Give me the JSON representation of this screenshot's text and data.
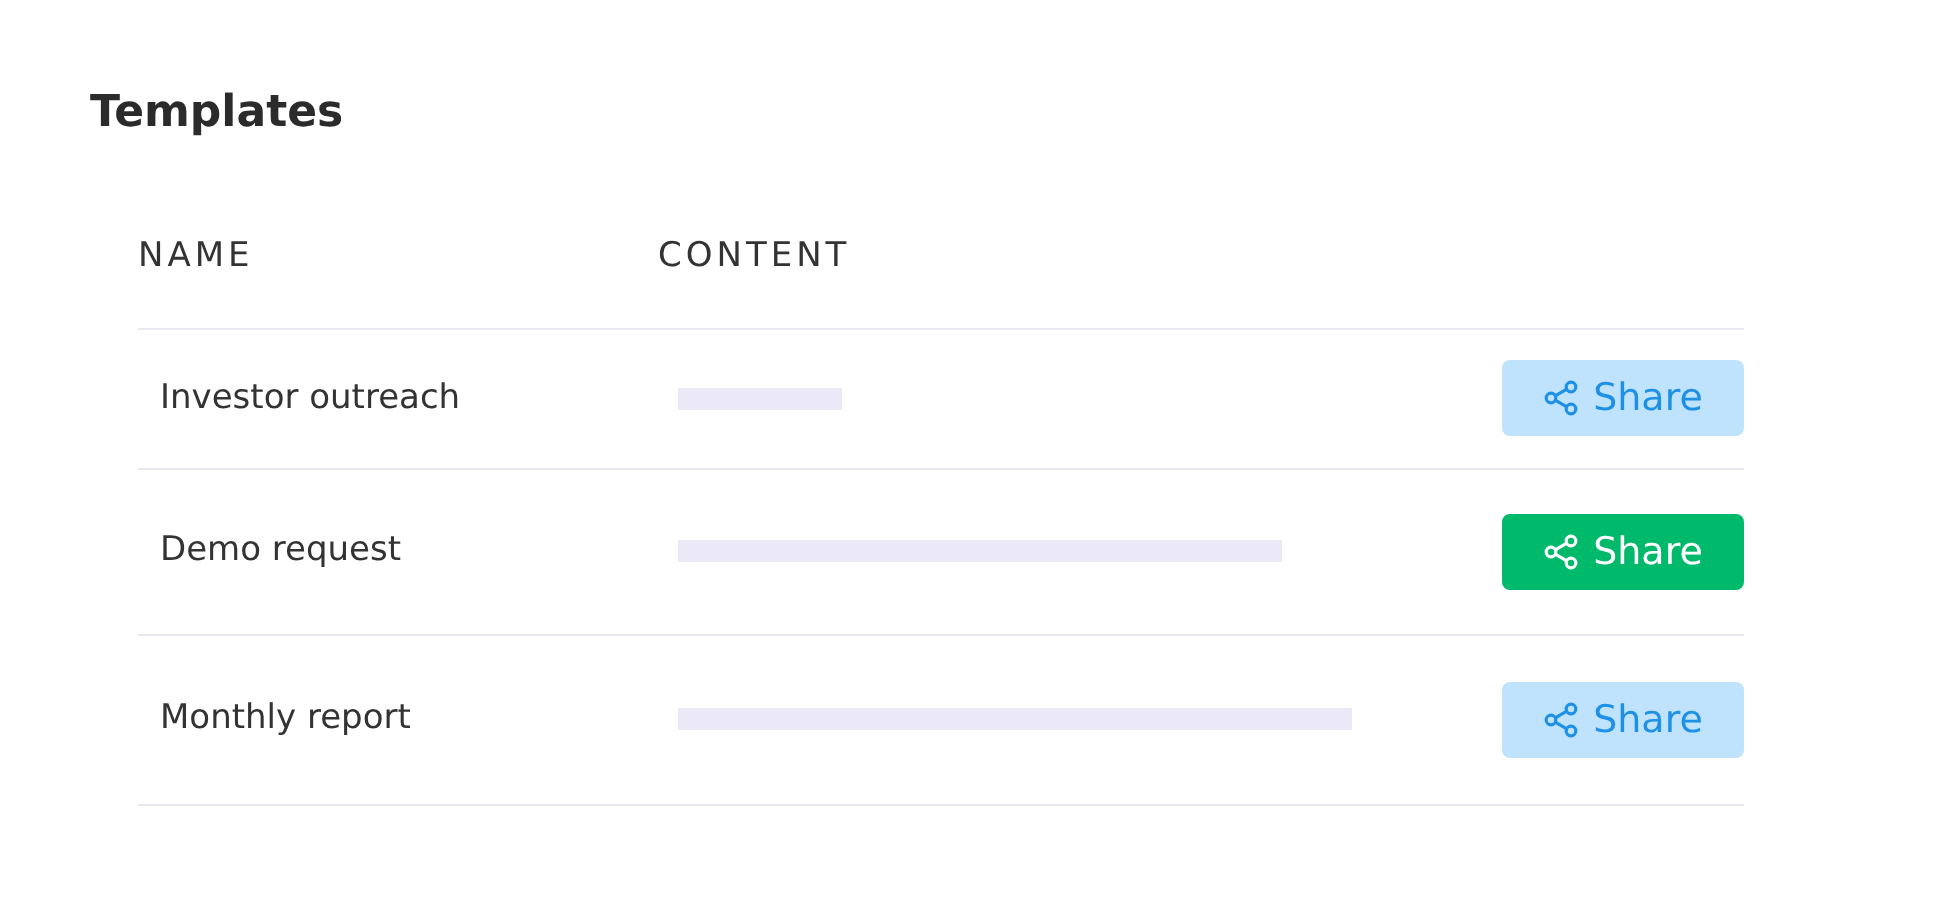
{
  "title": "Templates",
  "table": {
    "columns": [
      "NAME",
      "CONTENT"
    ],
    "rows": [
      {
        "name": "Investor outreach",
        "share": {
          "label": "Share",
          "selected": false
        }
      },
      {
        "name": "Demo request",
        "share": {
          "label": "Share",
          "selected": true
        }
      },
      {
        "name": "Monthly report",
        "share": {
          "label": "Share",
          "selected": false
        }
      }
    ]
  }
}
